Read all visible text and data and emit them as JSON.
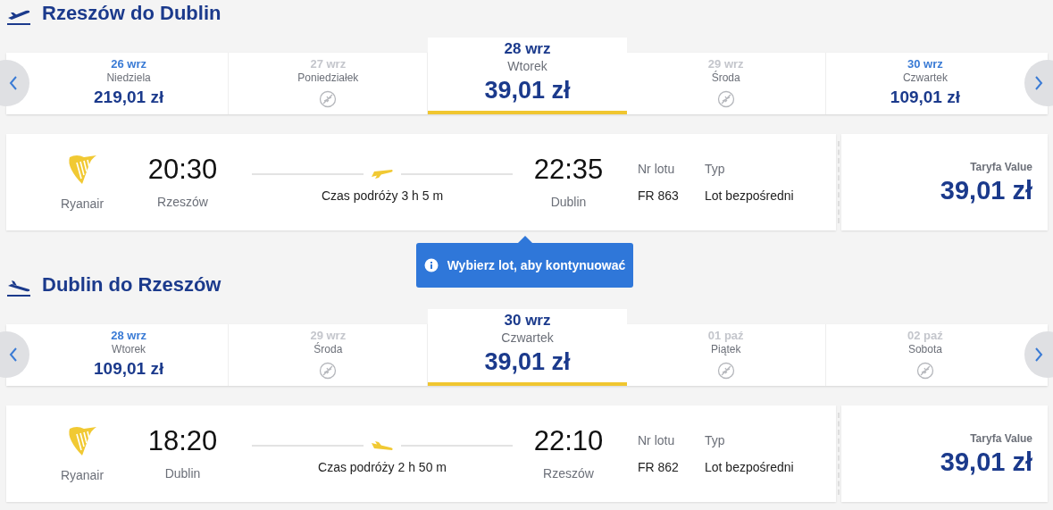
{
  "sections": [
    {
      "kind": "outbound",
      "title": "Rzeszów do Dublin",
      "days": [
        {
          "date": "26 wrz",
          "weekday": "Niedziela",
          "price": "219,01 zł",
          "available": true,
          "selected": false
        },
        {
          "date": "27 wrz",
          "weekday": "Poniedziałek",
          "available": false,
          "selected": false
        },
        {
          "date": "28 wrz",
          "weekday": "Wtorek",
          "price": "39,01 zł",
          "available": true,
          "selected": true
        },
        {
          "date": "29 wrz",
          "weekday": "Środa",
          "available": false,
          "selected": false
        },
        {
          "date": "30 wrz",
          "weekday": "Czwartek",
          "price": "109,01 zł",
          "available": true,
          "selected": false
        }
      ],
      "flight": {
        "airline": "Ryanair",
        "depart_time": "20:30",
        "depart_city": "Rzeszów",
        "duration": "Czas podróży 3 h 5 m",
        "arrive_time": "22:35",
        "arrive_city": "Dublin",
        "flight_no_label": "Nr lotu",
        "flight_no": "FR 863",
        "type_label": "Typ",
        "type": "Lot bezpośredni",
        "fare_label": "Taryfa Value",
        "fare_price": "39,01 zł"
      },
      "tooltip": "Wybierz lot, aby kontynuować"
    },
    {
      "kind": "inbound",
      "title": "Dublin do Rzeszów",
      "days": [
        {
          "date": "28 wrz",
          "weekday": "Wtorek",
          "price": "109,01 zł",
          "available": true,
          "selected": false
        },
        {
          "date": "29 wrz",
          "weekday": "Środa",
          "available": false,
          "selected": false
        },
        {
          "date": "30 wrz",
          "weekday": "Czwartek",
          "price": "39,01 zł",
          "available": true,
          "selected": true
        },
        {
          "date": "01 paź",
          "weekday": "Piątek",
          "available": false,
          "selected": false
        },
        {
          "date": "02 paź",
          "weekday": "Sobota",
          "available": false,
          "selected": false
        }
      ],
      "flight": {
        "airline": "Ryanair",
        "depart_time": "18:20",
        "depart_city": "Dublin",
        "duration": "Czas podróży 2 h 50 m",
        "arrive_time": "22:10",
        "arrive_city": "Rzeszów",
        "flight_no_label": "Nr lotu",
        "flight_no": "FR 862",
        "type_label": "Typ",
        "type": "Lot bezpośredni",
        "fare_label": "Taryfa Value",
        "fare_price": "39,01 zł"
      }
    }
  ]
}
